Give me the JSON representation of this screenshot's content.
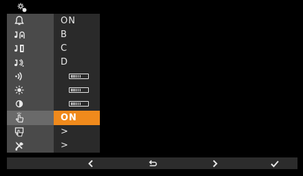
{
  "header": {
    "icon": "settings-gear-icon"
  },
  "menu": {
    "items": [
      {
        "icon": "bell-icon",
        "value": "ON"
      },
      {
        "icon": "ring-tone-door-icon",
        "value": "B"
      },
      {
        "icon": "ring-tone-entry-icon",
        "value": "C"
      },
      {
        "icon": "ring-tone-floor-icon",
        "value": "D"
      },
      {
        "icon": "volume-icon",
        "level": 0.6
      },
      {
        "icon": "brightness-icon",
        "level": 0.6
      },
      {
        "icon": "contrast-icon",
        "level": 0.6
      },
      {
        "icon": "touch-icon",
        "value": "ON",
        "selected": true
      },
      {
        "icon": "cleaning-icon",
        "value": ">"
      },
      {
        "icon": "tools-icon",
        "value": ">"
      }
    ]
  },
  "bottombar": {
    "buttons": [
      {
        "icon": "chevron-left-icon"
      },
      {
        "icon": "back-return-icon"
      },
      {
        "icon": "chevron-right-icon"
      },
      {
        "icon": "check-icon"
      }
    ]
  },
  "colors": {
    "accent": "#f08a1c",
    "icon_column": "#4a4a4a",
    "value_column": "#2a2a2a",
    "bar": "#2c2c2c"
  }
}
